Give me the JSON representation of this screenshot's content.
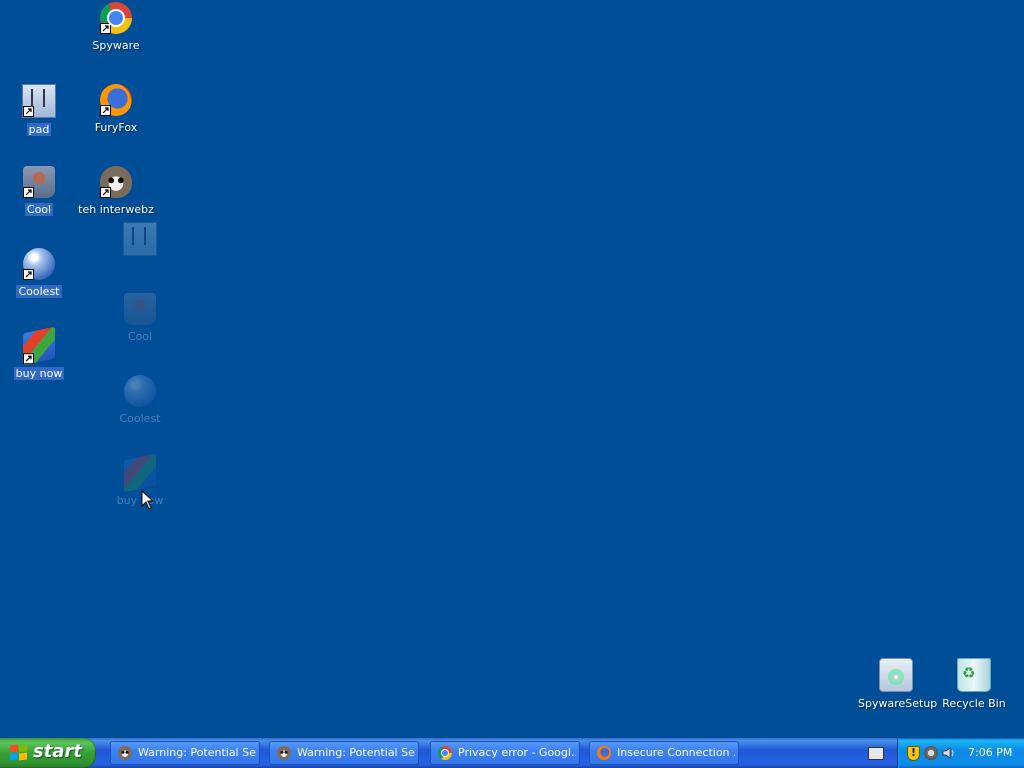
{
  "desktop": {
    "background_color": "#004e98",
    "icons": [
      {
        "label": "Spyware",
        "icon": "chrome-icon",
        "selected": false
      },
      {
        "label": "pad",
        "icon": "notepad-icon",
        "selected": true
      },
      {
        "label": "FuryFox",
        "icon": "firefox-icon",
        "selected": false
      },
      {
        "label": "Cool",
        "icon": "cool-app-icon",
        "selected": true
      },
      {
        "label": "teh interwebz",
        "icon": "raccoon-icon",
        "selected": false
      },
      {
        "label": "Coolest",
        "icon": "orb-icon",
        "selected": true
      },
      {
        "label": "buy now",
        "icon": "windows-flag-icon",
        "selected": true
      },
      {
        "label": "SpywareSetup",
        "icon": "setup-cd-icon",
        "selected": false
      },
      {
        "label": "Recycle Bin",
        "icon": "recycle-bin-icon",
        "selected": false
      }
    ],
    "drag_ghosts": [
      {
        "label": "",
        "icon": "notepad-icon"
      },
      {
        "label": "Cool",
        "icon": "cool-app-icon"
      },
      {
        "label": "Coolest",
        "icon": "orb-icon"
      },
      {
        "label": "buy now",
        "icon": "windows-flag-icon"
      }
    ]
  },
  "taskbar": {
    "start_label": "start",
    "tasks": [
      {
        "title": "Warning: Potential Se...",
        "icon": "raccoon-icon"
      },
      {
        "title": "Warning: Potential Se...",
        "icon": "raccoon-icon"
      },
      {
        "title": "Privacy error - Googl...",
        "icon": "chrome-icon"
      },
      {
        "title": "Insecure Connection ...",
        "icon": "firefox-icon"
      }
    ],
    "tray": {
      "icons": [
        "security-shield-icon",
        "network-icon",
        "volume-icon"
      ],
      "clock": "7:06 PM"
    },
    "keyboard_icon": "keyboard-icon"
  }
}
